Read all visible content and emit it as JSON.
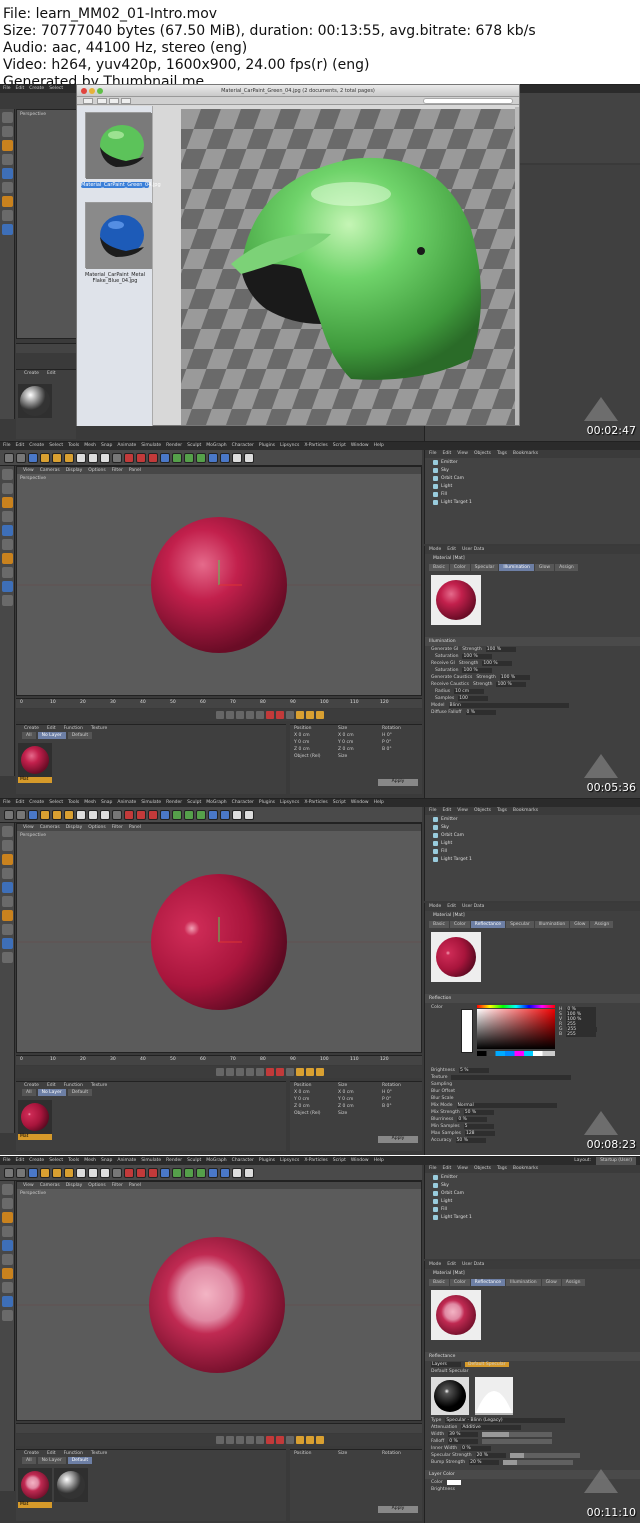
{
  "header": {
    "line1": "File: learn_MM02_01-Intro.mov",
    "line2": "Size: 70777040 bytes (67.50 MiB), duration: 00:13:55, avg.bitrate: 678 kb/s",
    "line3": "Audio: aac, 44100 Hz, stereo (eng)",
    "line4": "Video: h264, yuv420p, 1600x900, 24.00 fps(r) (eng)",
    "line5": "Generated by Thumbnail me"
  },
  "menu": [
    "File",
    "Edit",
    "Create",
    "Select",
    "Tools",
    "Mesh",
    "Snap",
    "Animate",
    "Simulate",
    "Render",
    "Sculpt",
    "MoGraph",
    "Character",
    "Plugins",
    "Lipsyncs",
    "X-Particles",
    "Script",
    "Window",
    "Help"
  ],
  "viewport_menu": [
    "View",
    "Cameras",
    "Display",
    "Options",
    "Filter",
    "Panel"
  ],
  "viewport_label": "Perspective",
  "timeline_ticks": [
    "0",
    "10",
    "20",
    "30",
    "40",
    "50",
    "60",
    "70",
    "80",
    "90",
    "100",
    "110",
    "120"
  ],
  "material_manager": {
    "menu": [
      "Create",
      "Edit",
      "Function",
      "Texture"
    ],
    "tabs": [
      "All",
      "No Layer",
      "Default"
    ],
    "swatch_label": "Mat"
  },
  "coords": {
    "headers": [
      "Position",
      "Size",
      "Rotation"
    ],
    "rows": [
      [
        "X 0 cm",
        "X 0 cm",
        "H 0°"
      ],
      [
        "Y 0 cm",
        "Y 0 cm",
        "P 0°"
      ],
      [
        "Z 0 cm",
        "Z 0 cm",
        "B 0°"
      ]
    ],
    "mode": "Object (Rel)",
    "size_mode": "Size",
    "apply": "Apply"
  },
  "object_manager": {
    "menu": [
      "File",
      "Edit",
      "View",
      "Objects",
      "Tags",
      "Bookmarks"
    ],
    "items": [
      "Emitter",
      "Sky",
      "Orbit Cam",
      "Light",
      "Fill",
      "Light Target 1"
    ]
  },
  "attr_menu": [
    "Mode",
    "Edit",
    "User Data"
  ],
  "attr_title": "Material [Mat]",
  "frame2": {
    "tabs": [
      "Basic",
      "Color",
      "Specular",
      "Illumination",
      "Glow",
      "Assign"
    ],
    "active_tab": "Illumination",
    "section": "Illumination",
    "rows": [
      [
        "Generate GI",
        "Strength",
        "100 %"
      ],
      [
        "",
        "Saturation",
        "100 %"
      ],
      [
        "Receive GI",
        "Strength",
        "100 %"
      ],
      [
        "",
        "Saturation",
        "100 %"
      ],
      [
        "Generate Caustics",
        "Strength",
        "100 %"
      ],
      [
        "Receive Caustics",
        "Strength",
        "100 %"
      ],
      [
        "",
        "Radius",
        "10 cm"
      ],
      [
        "",
        "Samples",
        "100"
      ]
    ],
    "model_label": "Model",
    "model_value": "Blinn",
    "diffuse_falloff": "Diffuse Falloff",
    "diffuse_value": "0 %",
    "timestamp": "00:05:36"
  },
  "frame3": {
    "tabs": [
      "Basic",
      "Color",
      "Reflectance",
      "Specular",
      "Illumination",
      "Glow",
      "Assign"
    ],
    "active_tab": "Reflectance",
    "section": "Reflection",
    "color_label": "Color",
    "rgb": [
      [
        "H",
        "0 %"
      ],
      [
        "S",
        "100 %"
      ],
      [
        "V",
        "100 %"
      ],
      [
        "R",
        "255"
      ],
      [
        "G",
        "255"
      ],
      [
        "B",
        "255"
      ]
    ],
    "brightness_label": "Brightness",
    "brightness_value": "5 %",
    "texture_label": "Texture",
    "sampling_label": "Sampling",
    "blur_offset": "Blur Offset",
    "blur_scale": "Blur Scale",
    "mix_mode": "Mix Mode",
    "mix_mode_value": "Normal",
    "rows": [
      [
        "Mix Strength",
        "50 %"
      ],
      [
        "Blurriness",
        "0 %"
      ],
      [
        "Min Samples",
        "5"
      ],
      [
        "Max Samples",
        "128"
      ],
      [
        "Accuracy",
        "50 %"
      ]
    ],
    "timestamp": "00:08:23"
  },
  "frame4": {
    "tabs": [
      "Basic",
      "Color",
      "Reflectance",
      "Illumination",
      "Glow",
      "Assign"
    ],
    "active_tab": "Reflectance",
    "section": "Reflectance",
    "layers_btn": "Layers",
    "default_spec": "Default Specular",
    "type_label": "Type",
    "type_value": "Specular - Blinn (Legacy)",
    "rows": [
      [
        "Attenuation",
        "Additive"
      ],
      [
        "Width",
        "39 %"
      ],
      [
        "Falloff",
        "0 %"
      ],
      [
        "Inner Width",
        "0 %"
      ],
      [
        "Specular Strength",
        "20 %"
      ],
      [
        "Bump Strength",
        "20 %"
      ]
    ],
    "layer_color": "Layer Color",
    "color_label": "Color",
    "brightness_label": "Brightness",
    "timestamp": "00:11:10",
    "layout_label": "Layout:",
    "layout_value": "Startup (User)"
  },
  "frame1": {
    "viewer_title": "Material_CarPaint_Green_04.jpg (2 documents, 2 total pages)",
    "thumb1_label": "Material_CarPaint_Green_04.jpg",
    "thumb2_label": "Material_CarPaint_Metal Flake_Blue_04.jpg",
    "timestamp": "00:02:47"
  },
  "colors": {
    "accent_orange": "#d69a2a",
    "sphere_red": "#b81c45",
    "helmet_green": "#5cc35a",
    "helmet_blue": "#1d5bb8",
    "selection_blue": "#3b7fd8"
  }
}
